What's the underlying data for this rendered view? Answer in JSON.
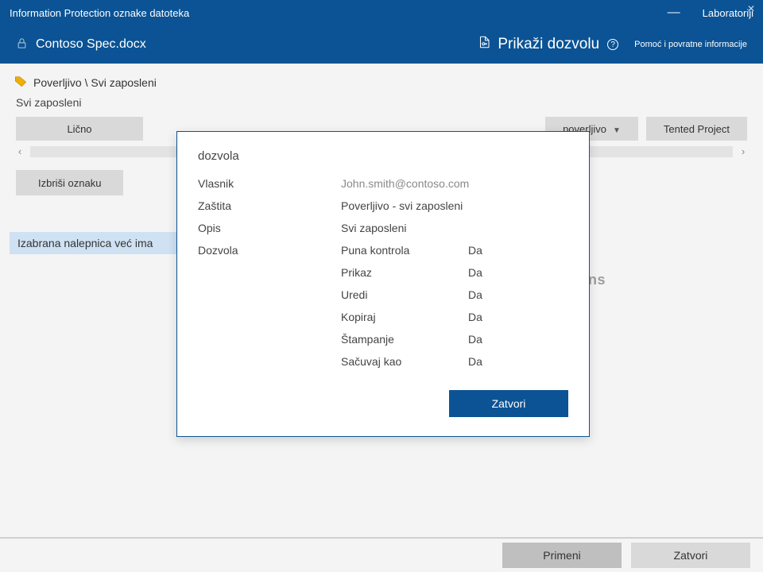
{
  "titlebar": {
    "title": "Information Protection oznake datoteka",
    "lab": "Laboratoriji"
  },
  "subbar": {
    "filename": "Contoso Spec.docx",
    "show_permission": "Prikaži dozvolu",
    "help": "Pomoć i povratne informacije"
  },
  "breadcrumb": "Poverljivo \\ Svi zaposleni",
  "section_heading": "Svi zaposleni",
  "labels": {
    "licno": "Lično",
    "poverljivo": "poverljivo",
    "tented": "Tented Project"
  },
  "delete_label": "Izbriši oznaku",
  "selected_msg": "Izabrana nalepnica već ima",
  "footer": {
    "apply": "Primeni",
    "close": "Zatvori"
  },
  "modal": {
    "title": "dozvola",
    "owner_label": "Vlasnik",
    "owner_value": "John.smith@contoso.com",
    "protection_label": "Zaštita",
    "protection_value": "Poverljivo - svi zaposleni",
    "description_label": "Opis",
    "description_value": "Svi zaposleni",
    "permission_label": "Dozvola",
    "permissions": [
      {
        "name": "Puna kontrola",
        "value": "Da"
      },
      {
        "name": "Prikaz",
        "value": "Da"
      },
      {
        "name": "Uredi",
        "value": "Da"
      },
      {
        "name": "Kopiraj",
        "value": "Da"
      },
      {
        "name": "Štampanje",
        "value": "Da"
      },
      {
        "name": "Sačuvaj kao",
        "value": "Da"
      }
    ],
    "close": "Zatvori"
  }
}
